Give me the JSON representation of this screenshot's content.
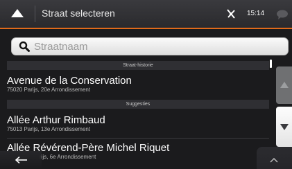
{
  "header": {
    "title": "Straat selecteren",
    "time": "15:14",
    "up_icon": "chevron-up-icon",
    "gps_icon": "satellite-icon",
    "message_icon": "speech-bubble-icon"
  },
  "colors": {
    "accent": "#e06a1a"
  },
  "search": {
    "value": "",
    "placeholder": "Straatnaam",
    "icon": "search-icon"
  },
  "sections": {
    "history": "Straat-historie",
    "suggestions": "Suggesties"
  },
  "results": [
    {
      "name": "Avenue de la Conservation",
      "detail": "75020 Parijs, 20e Arrondissement"
    },
    {
      "name": "Allée Arthur Rimbaud",
      "detail": "75013 Parijs, 13e Arrondissement"
    },
    {
      "name": "Allée Révérend-Père Michel Riquet",
      "detail": "rijs, 6e Arrondissement"
    }
  ],
  "footer": {
    "back_icon": "arrow-left-icon",
    "more_icon": "chevron-up-icon"
  }
}
